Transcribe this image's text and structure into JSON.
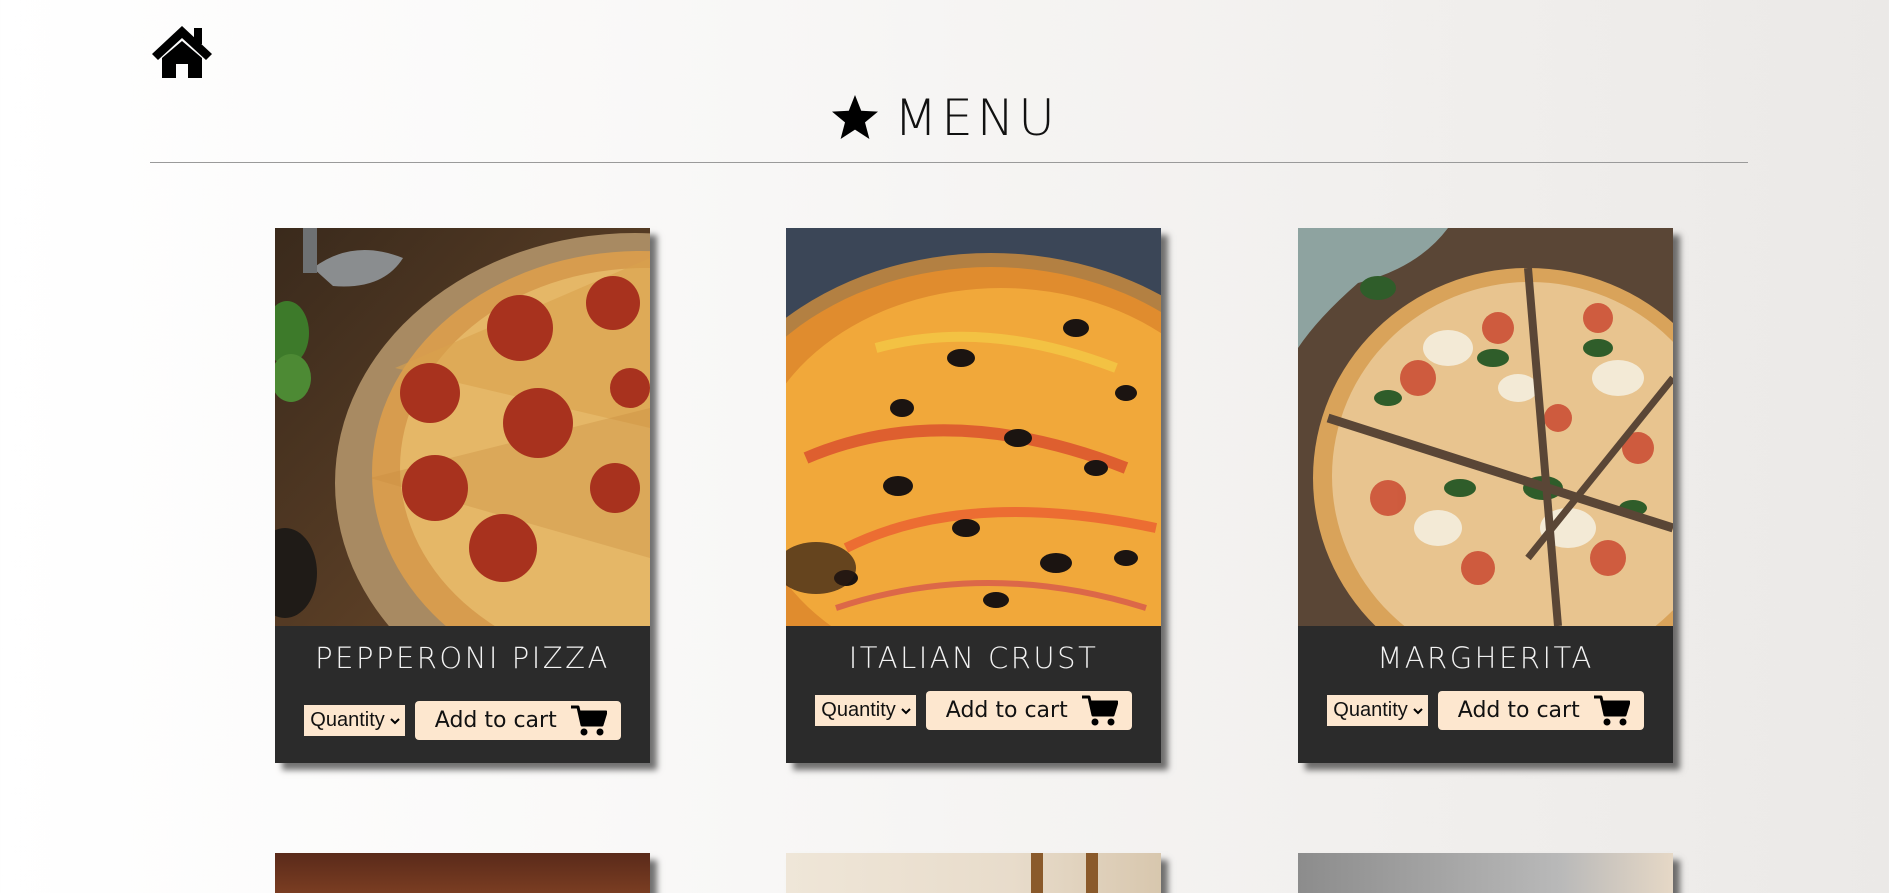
{
  "nav": {
    "home_icon": "home-icon"
  },
  "header": {
    "title": "MENU",
    "icon": "star-icon"
  },
  "products": [
    {
      "name": "PEPPERONI PIZZA",
      "quantity_label": "Quantity",
      "add_label": "Add to cart",
      "cart_icon": "shopping-cart-icon"
    },
    {
      "name": "ITALIAN CRUST",
      "quantity_label": "Quantity",
      "add_label": "Add to cart",
      "cart_icon": "shopping-cart-icon"
    },
    {
      "name": "MARGHERITA",
      "quantity_label": "Quantity",
      "add_label": "Add to cart",
      "cart_icon": "shopping-cart-icon"
    }
  ],
  "colors": {
    "card_background": "#2b2b2b",
    "button_background": "#fde7cf",
    "title_text": "#f2f2f2"
  }
}
